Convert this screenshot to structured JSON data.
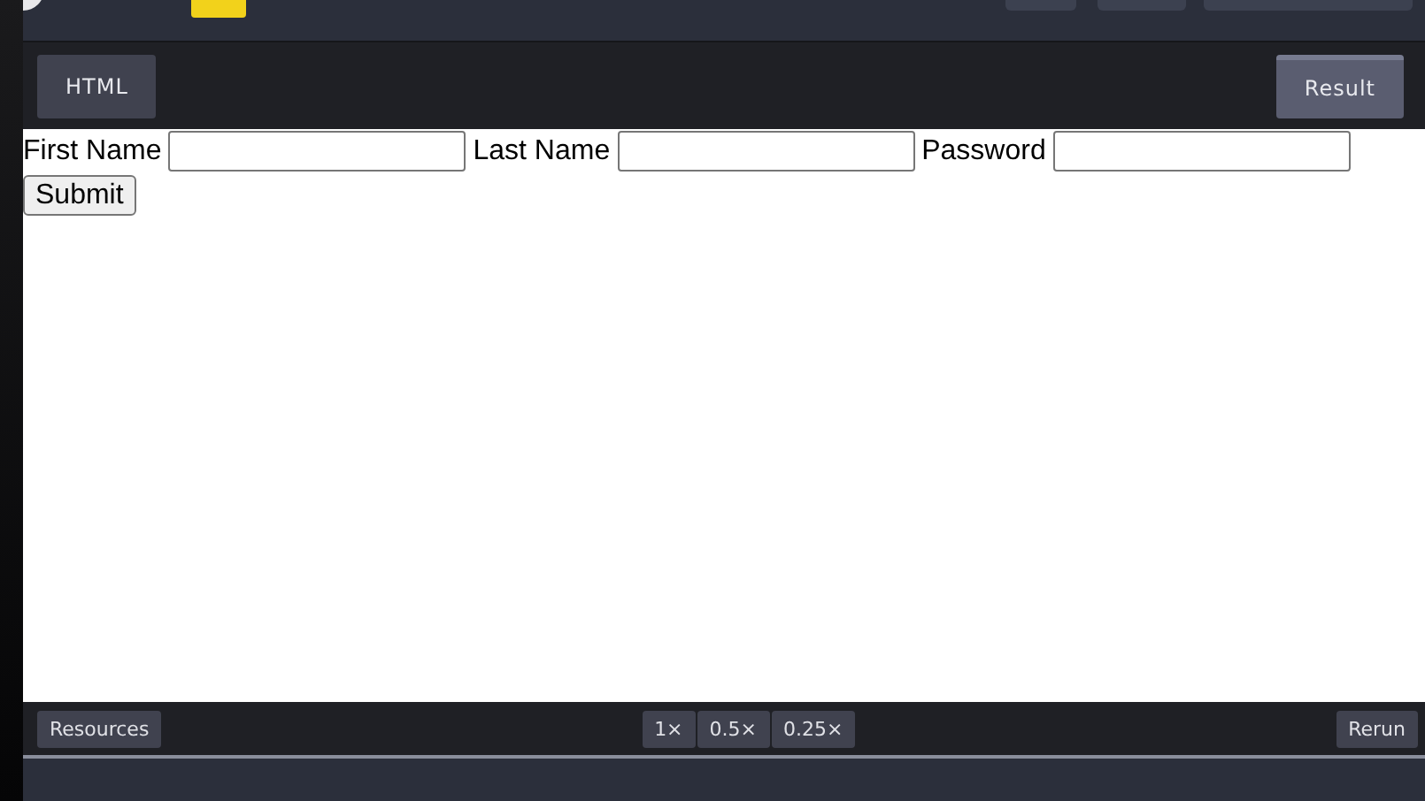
{
  "tabs": [
    {
      "label": "HTML",
      "selected": false
    },
    {
      "label": "Result",
      "selected": true
    }
  ],
  "form": {
    "fields": [
      {
        "label": "First Name"
      },
      {
        "label": "Last Name"
      },
      {
        "label": "Password"
      }
    ],
    "submit": "Submit"
  },
  "footer": {
    "resources": "Resources",
    "zoom": [
      {
        "label": "1×",
        "selected": false
      },
      {
        "label": "0.5×",
        "selected": false
      },
      {
        "label": "0.25×",
        "selected": false
      }
    ],
    "rerun": "Rerun"
  }
}
